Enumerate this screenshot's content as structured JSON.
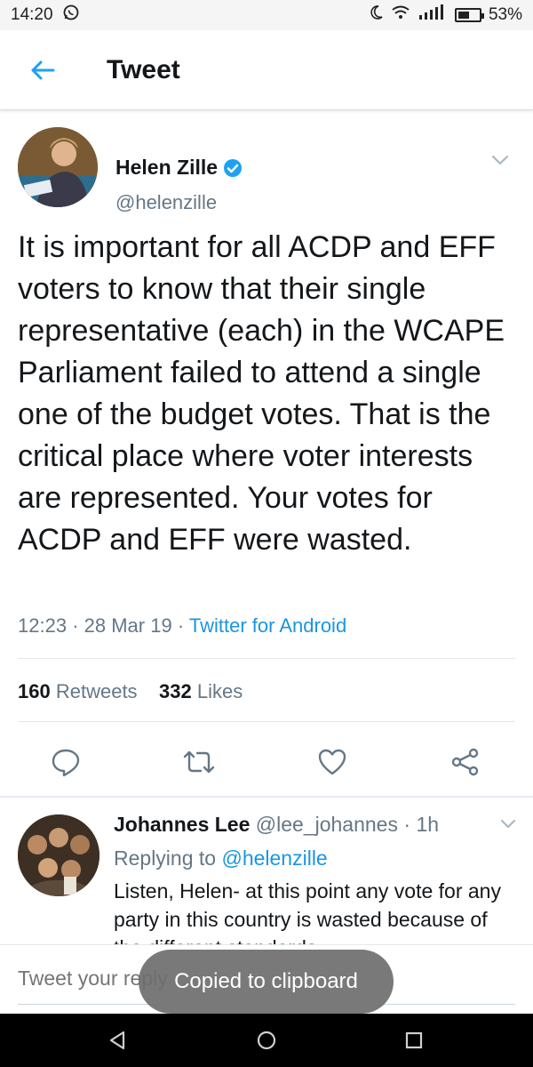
{
  "status_bar": {
    "time": "14:20",
    "battery": "53%",
    "battery_level": 0.53
  },
  "header": {
    "title": "Tweet",
    "back_icon": "arrow-left-icon"
  },
  "tweet": {
    "author_name": "Helen Zille",
    "author_handle": "@helenzille",
    "text": "It is important for all ACDP and EFF voters to know that their single representative (each) in the WCAPE Parliament failed to attend a single one of the budget votes. That is the critical place where voter interests are represented. Your votes for ACDP and EFF were wasted.",
    "time": "12:23",
    "date": "28 Mar 19",
    "source": "Twitter for Android",
    "retweets_count": "160",
    "retweets_label": "Retweets",
    "likes_count": "332",
    "likes_label": "Likes"
  },
  "reply": {
    "name": "Johannes Lee",
    "handle": "@lee_johannes",
    "age": "1h",
    "replying_label": "Replying to",
    "replying_to": "@helenzille",
    "text": "Listen, Helen- at this point any vote for any party in this country is wasted because of the different standards"
  },
  "compose": {
    "placeholder": "Tweet your reply"
  },
  "toast": "Copied to clipboard",
  "colors": {
    "accent": "#1da1f2",
    "link": "#1b95e0",
    "muted": "#657786"
  }
}
